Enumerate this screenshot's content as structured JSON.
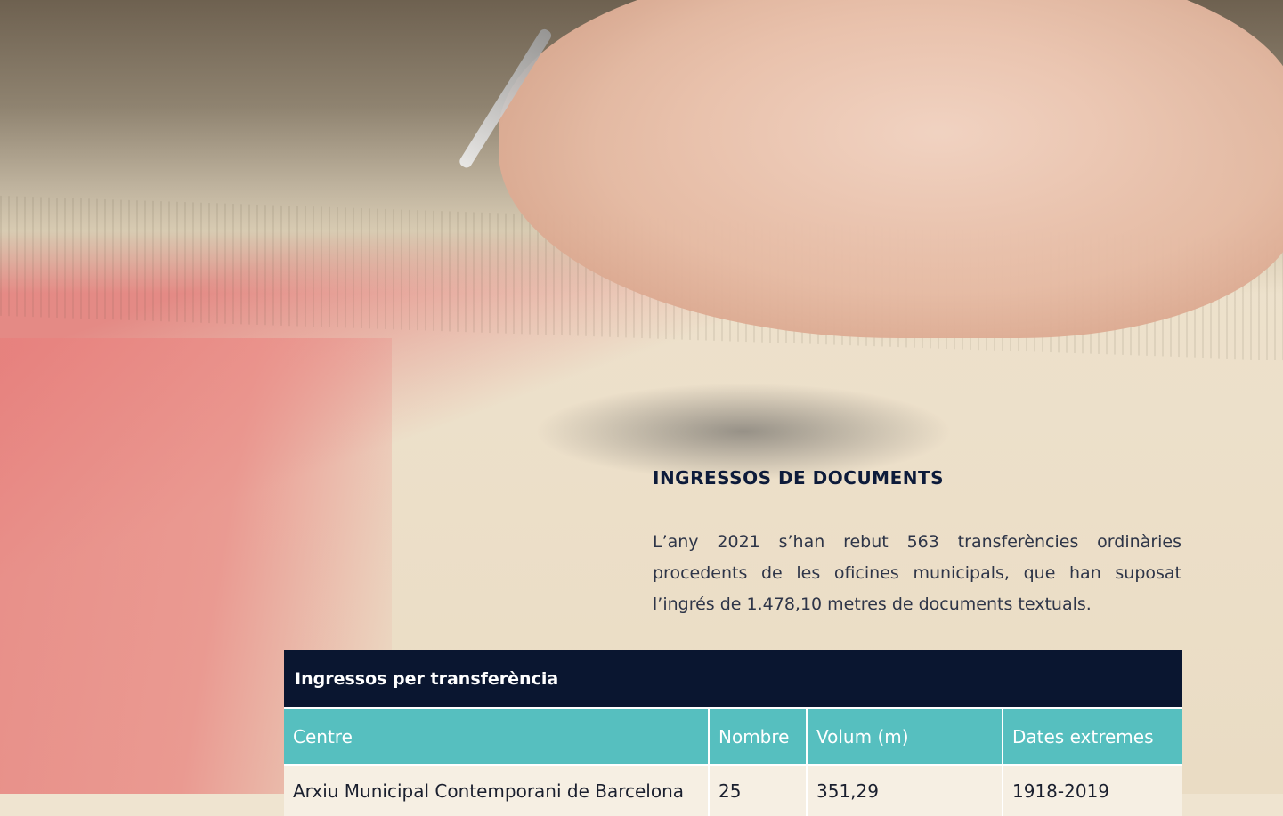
{
  "section": {
    "title": "INGRESSOS DE DOCUMENTS",
    "paragraph": "L’any 2021 s’han rebut 563 transferències ordinàries procedents de les oficines municipals, que han suposat l’ingrés de 1.478,10 metres de documents textuals."
  },
  "table": {
    "caption": "Ingressos per transferència",
    "headers": [
      "Centre",
      "Nombre",
      "Volum (m)",
      "Dates extremes"
    ],
    "rows": [
      [
        "Arxiu Municipal Contemporani de Barcelona",
        "25",
        "351,29",
        "1918-2019"
      ]
    ]
  },
  "colors": {
    "title": "#0d1b3a",
    "caption_bg": "#0a1630",
    "header_bg": "#56bfbf",
    "row_bg": "#f6efe3"
  }
}
